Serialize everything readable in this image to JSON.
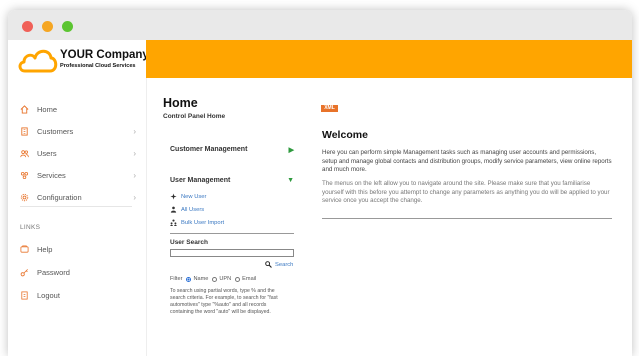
{
  "brand": {
    "company": "YOUR Company",
    "tagline": "Professional Cloud Services",
    "accent_color": "#ffa500"
  },
  "sidebar": {
    "items": [
      {
        "label": "Home",
        "icon": "home-icon",
        "has_submenu": false
      },
      {
        "label": "Customers",
        "icon": "building-icon",
        "has_submenu": true
      },
      {
        "label": "Users",
        "icon": "users-icon",
        "has_submenu": true
      },
      {
        "label": "Services",
        "icon": "services-icon",
        "has_submenu": true
      },
      {
        "label": "Configuration",
        "icon": "gear-icon",
        "has_submenu": true
      }
    ],
    "links_label": "LINKS",
    "links": [
      {
        "label": "Help",
        "icon": "help-icon"
      },
      {
        "label": "Password",
        "icon": "key-icon"
      },
      {
        "label": "Logout",
        "icon": "logout-icon"
      }
    ]
  },
  "main": {
    "title": "Home",
    "subtitle": "Control Panel Home",
    "customer_management": {
      "label": "Customer Management"
    },
    "user_management": {
      "label": "User Management",
      "links": [
        {
          "label": "New User",
          "icon": "new-user-icon"
        },
        {
          "label": "All Users",
          "icon": "all-users-icon"
        },
        {
          "label": "Bulk User Import",
          "icon": "bulk-import-icon"
        }
      ]
    },
    "user_search": {
      "label": "User Search",
      "value": "",
      "search_label": "Search",
      "filter_label": "Filter",
      "filter_options": [
        "Name",
        "UPN",
        "Email"
      ],
      "selected_filter": "Name",
      "help": "To search using partial words, type % and the search criteria. For example, to search for \"fast automotives\" type \"%auto\" and all records containing the word \"auto\" will be displayed."
    }
  },
  "welcome": {
    "badge": "XML",
    "title": "Welcome",
    "paragraph1": "Here you can perform simple Management tasks such as managing user accounts and permissions, setup and manage global contacts and distribution groups, modify service parameters, view online reports and much more.",
    "paragraph2": "The menus on the left allow you to navigate around the site. Please make sure that you familiarise yourself with this before you attempt to change any parameters as anything you do will be applied to your service once you accept the change."
  }
}
